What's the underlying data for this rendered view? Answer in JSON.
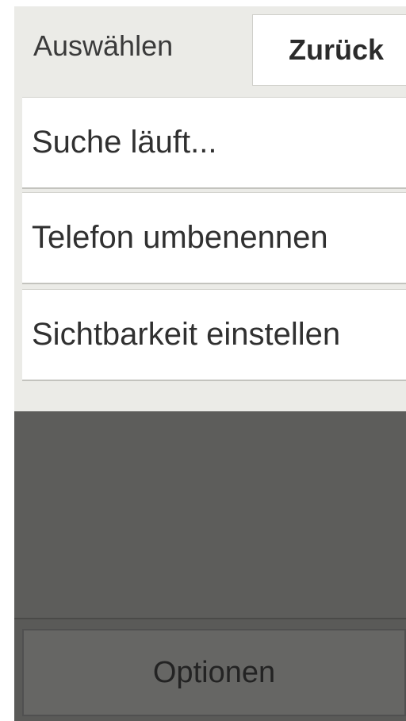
{
  "header": {
    "title": "Auswählen",
    "back_label": "Zurück"
  },
  "menu": {
    "items": [
      {
        "label": "Suche läuft..."
      },
      {
        "label": "Telefon umbenennen"
      },
      {
        "label": "Sichtbarkeit einstellen"
      }
    ]
  },
  "footer": {
    "options_label": "Optionen"
  }
}
